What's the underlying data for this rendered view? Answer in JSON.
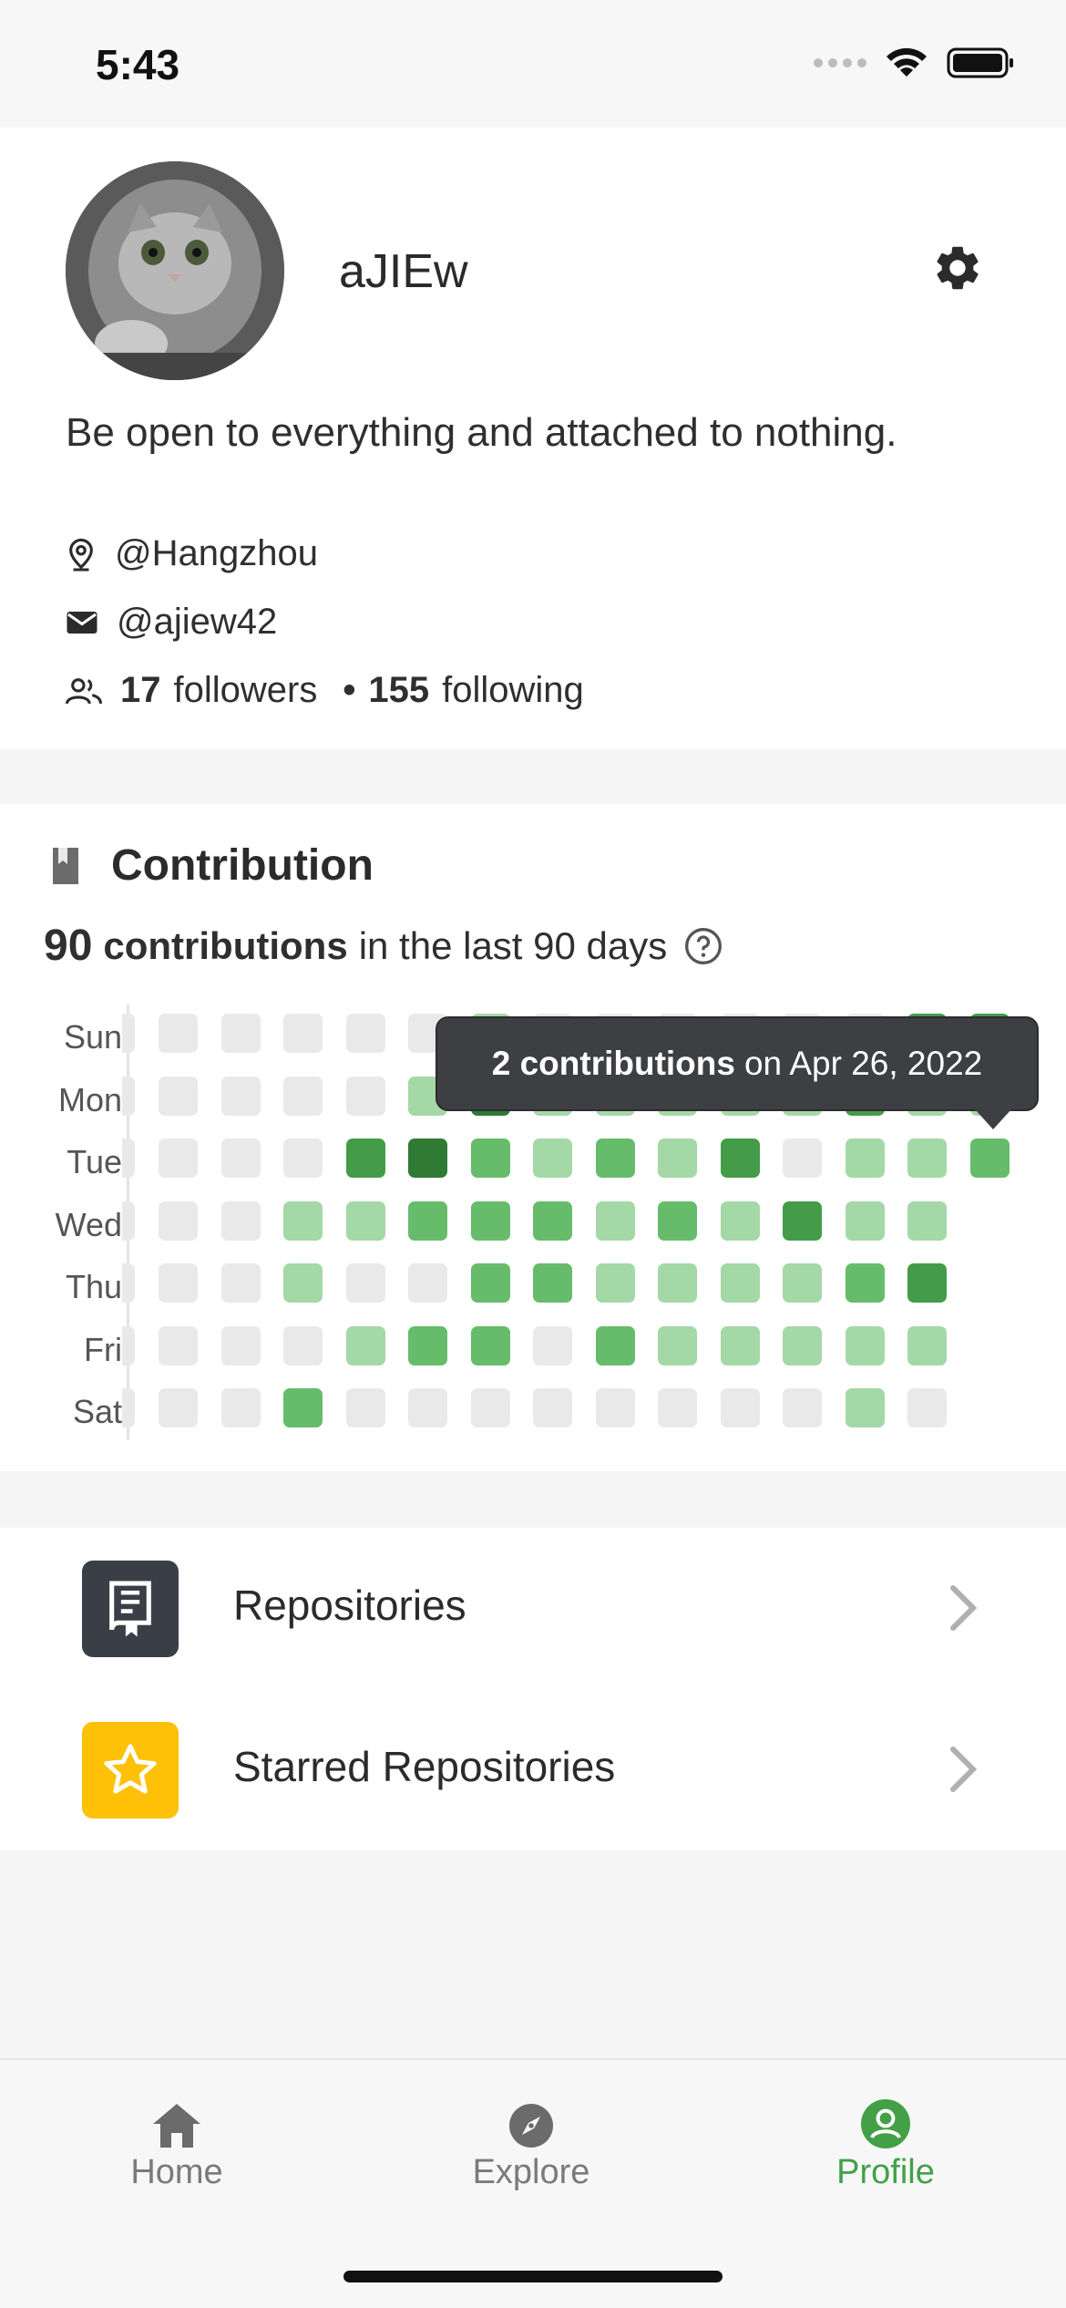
{
  "status_bar": {
    "time": "5:43"
  },
  "profile": {
    "username": "aJIEw",
    "bio": "Be open to everything and attached to nothing.",
    "location": "@Hangzhou",
    "email": "@ajiew42",
    "followers_count": "17",
    "followers_label": "followers",
    "separator": "•",
    "following_count": "155",
    "following_label": "following"
  },
  "contribution": {
    "title": "Contribution",
    "count": "90",
    "count_label": "contributions",
    "period_text": "in the last 90 days",
    "day_labels": [
      "Sun",
      "Mon",
      "Tue",
      "Wed",
      "Thu",
      "Fri",
      "Sat"
    ],
    "levels": [
      [
        0,
        0,
        0,
        0,
        0,
        1,
        0,
        0,
        0,
        0,
        0,
        0,
        3,
        3
      ],
      [
        0,
        0,
        0,
        0,
        1,
        4,
        1,
        1,
        1,
        1,
        1,
        3,
        1,
        1
      ],
      [
        0,
        0,
        0,
        3,
        4,
        2,
        1,
        2,
        1,
        3,
        0,
        1,
        1,
        2
      ],
      [
        0,
        0,
        1,
        1,
        2,
        2,
        2,
        1,
        2,
        1,
        3,
        1,
        1
      ],
      [
        0,
        0,
        1,
        0,
        0,
        2,
        2,
        1,
        1,
        1,
        1,
        2,
        3
      ],
      [
        0,
        0,
        0,
        1,
        2,
        2,
        0,
        2,
        1,
        1,
        1,
        1,
        1
      ],
      [
        0,
        0,
        2,
        0,
        0,
        0,
        0,
        0,
        0,
        0,
        0,
        1,
        0
      ]
    ],
    "colors": [
      "#e9e9e9",
      "#a5d8a7",
      "#67bc6b",
      "#449c48",
      "#2f7a34"
    ],
    "tooltip": {
      "count_text": "2 contributions",
      "date_text": "on Apr 26, 2022"
    }
  },
  "menu": {
    "items": [
      {
        "label": "Repositories",
        "icon": "repo-icon",
        "icon_bg": "#3a3f47"
      },
      {
        "label": "Starred Repositories",
        "icon": "star-icon",
        "icon_bg": "#ffc107"
      }
    ]
  },
  "nav": {
    "items": [
      {
        "label": "Home",
        "icon": "home-icon"
      },
      {
        "label": "Explore",
        "icon": "compass-icon"
      },
      {
        "label": "Profile",
        "icon": "profile-icon",
        "active": true
      }
    ],
    "active_color": "#43a047"
  }
}
